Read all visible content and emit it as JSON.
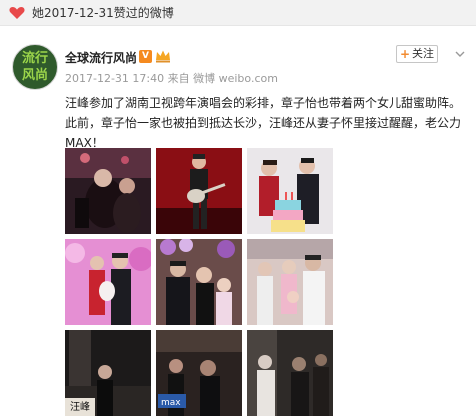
{
  "header": {
    "liked_text": "她2017-12-31赞过的微博"
  },
  "post": {
    "author": "全球流行风尚",
    "vip_badge": "V",
    "timestamp": "2017-12-31 17:40 来自 微博 weibo.com",
    "follow_label": "关注",
    "follow_plus": "+",
    "text_lines": [
      "汪峰参加了湖南卫视跨年演唱会的彩排，章子怡也带着两个女儿甜蜜助阵。",
      "此前，章子怡一家也被拍到抵达长沙，汪峰还从妻子怀里接过醒醒，老公力",
      "MAX！"
    ],
    "avatar_text": [
      "流行",
      "风尚"
    ]
  },
  "photos": [
    {
      "icon": "concert-crowd-photo"
    },
    {
      "icon": "guitar-performer-photo"
    },
    {
      "icon": "birthday-cake-couple-photo"
    },
    {
      "icon": "pink-party-family-photo"
    },
    {
      "icon": "balloon-family-photo"
    },
    {
      "icon": "family-with-child-photo"
    },
    {
      "icon": "night-arrival-photo",
      "caption": "汪峰"
    },
    {
      "icon": "airport-crowd-photo",
      "caption": "max"
    },
    {
      "icon": "dark-street-photo"
    }
  ],
  "colors": {
    "accent": "#f58a1f",
    "heart": "#e8494a",
    "meta": "#9a9a9a"
  }
}
